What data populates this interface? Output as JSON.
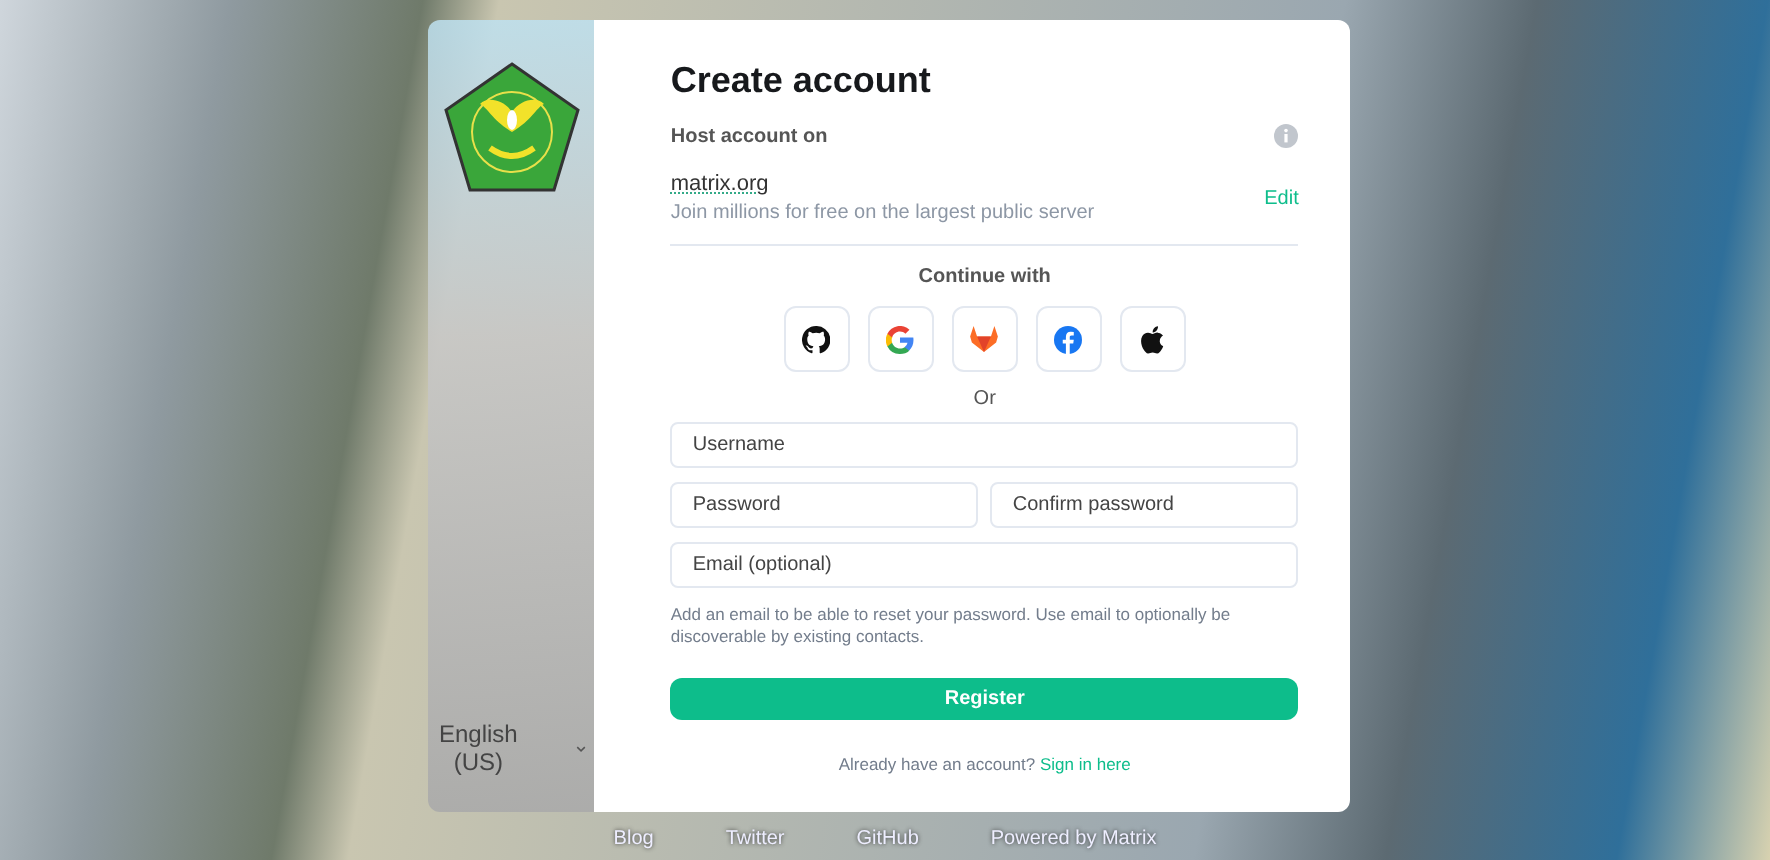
{
  "side_panel": {
    "language": "English (US)"
  },
  "form": {
    "title": "Create account",
    "host_label": "Host account on",
    "server": "matrix.org",
    "server_description": "Join millions for free on the largest public server",
    "edit_link": "Edit",
    "continue_with": "Continue with",
    "sso_providers": [
      {
        "kind": "github"
      },
      {
        "kind": "google"
      },
      {
        "kind": "gitlab"
      },
      {
        "kind": "facebook"
      },
      {
        "kind": "apple"
      }
    ],
    "or": "Or",
    "field_rows": [
      [
        {
          "placeholder": "Username"
        }
      ],
      [
        {
          "placeholder": "Password"
        },
        {
          "placeholder": "Confirm password"
        }
      ],
      [
        {
          "placeholder": "Email (optional)"
        }
      ]
    ],
    "email_hint": "Add an email to be able to reset your password. Use email to optionally be discoverable by existing contacts.",
    "register_button": "Register",
    "signin_prompt": "Already have an account?",
    "signin_link": "Sign in here"
  },
  "footer_links": [
    "Blog",
    "Twitter",
    "GitHub",
    "Powered by Matrix"
  ]
}
